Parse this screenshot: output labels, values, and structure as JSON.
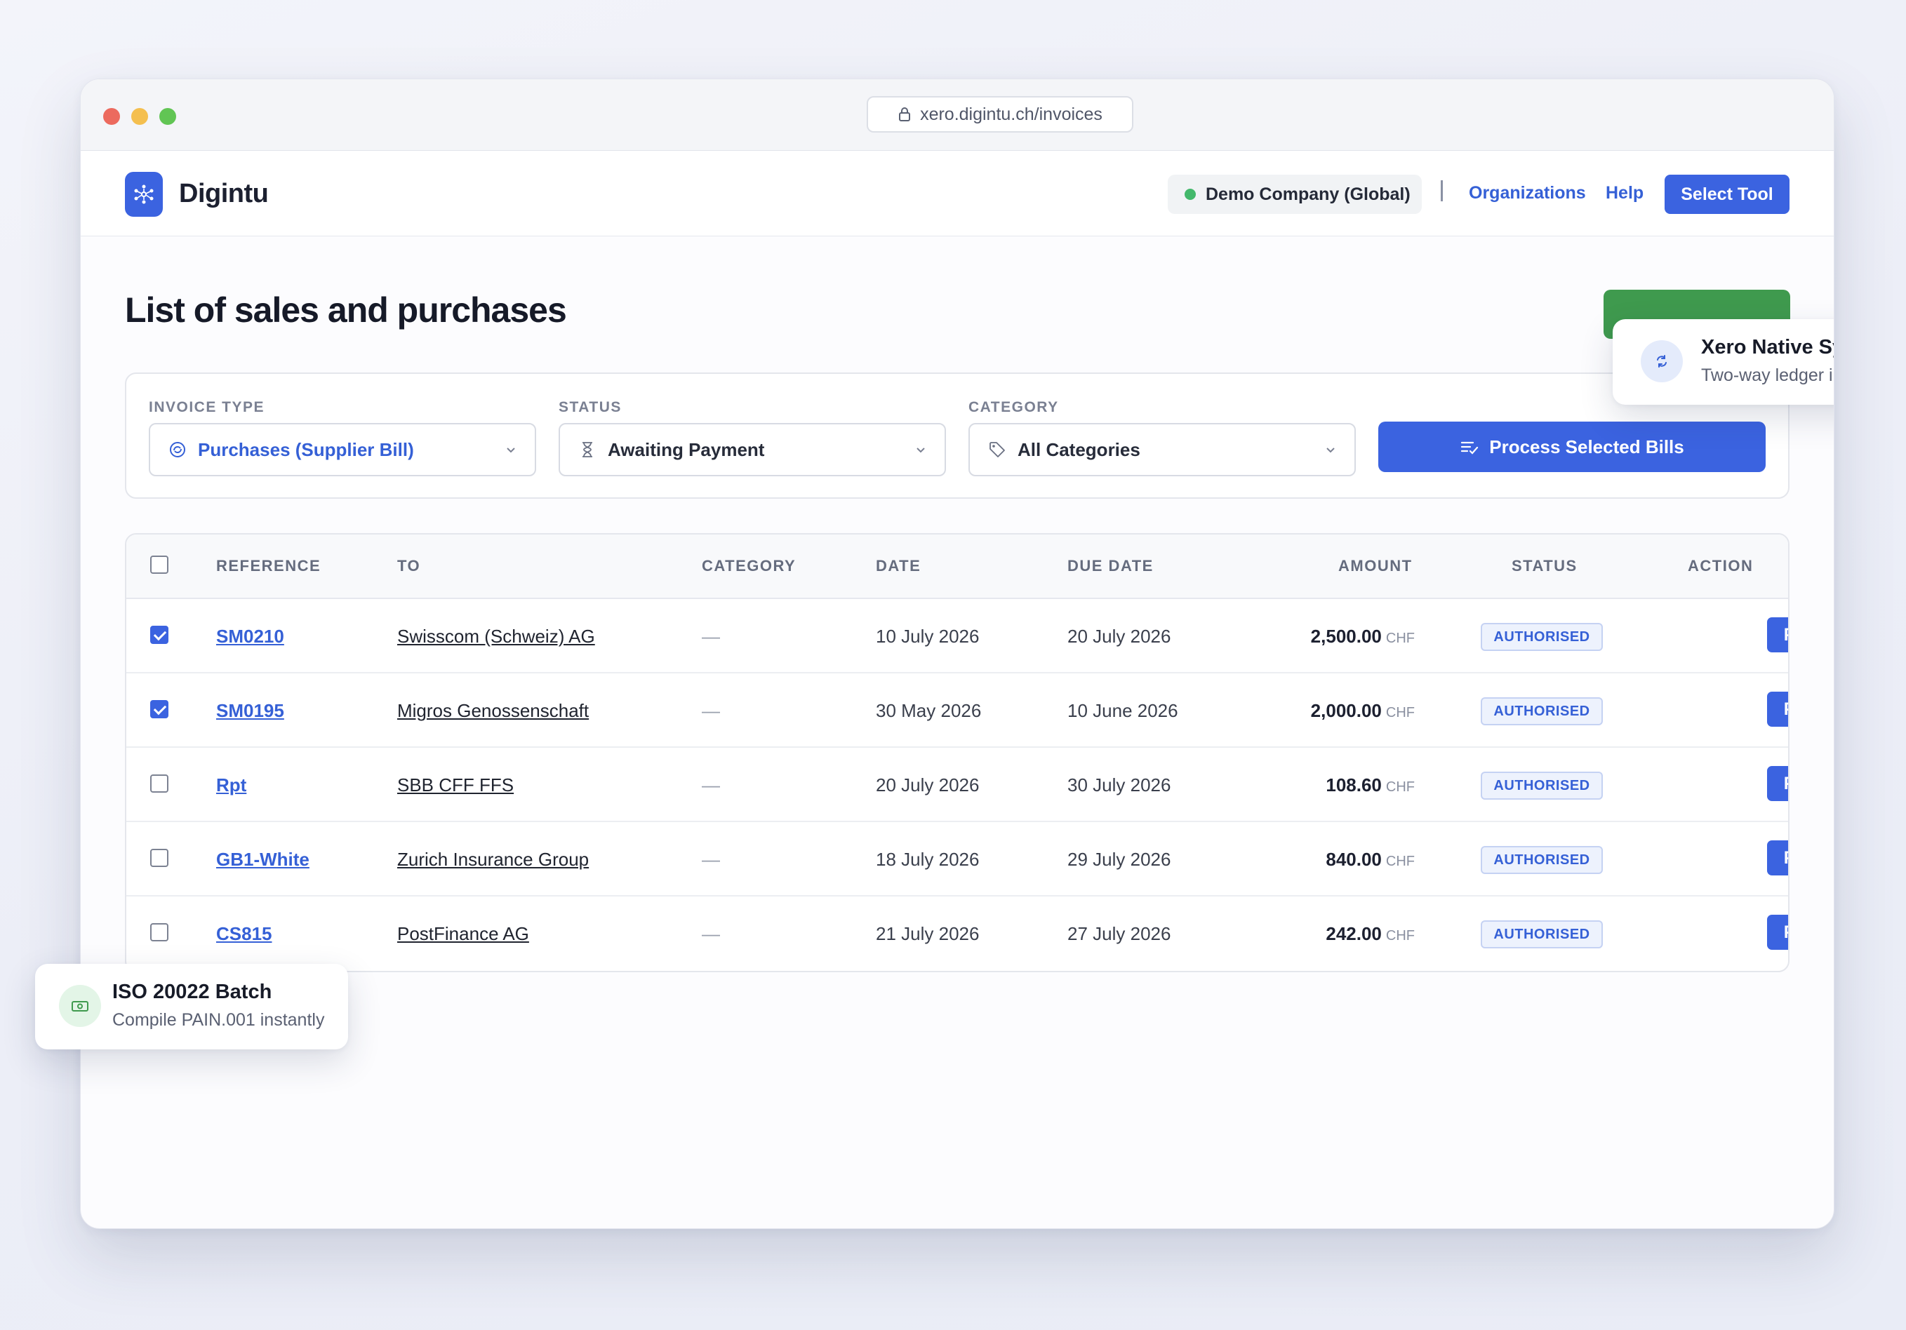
{
  "browser": {
    "url": "xero.digintu.ch/invoices"
  },
  "header": {
    "brand": "Digintu",
    "company": "Demo Company (Global)",
    "nav": {
      "organizations": "Organizations",
      "help": "Help",
      "select_tool": "Select Tool"
    }
  },
  "page": {
    "title": "List of sales and purchases"
  },
  "filters": {
    "invoice_type": {
      "label": "INVOICE TYPE",
      "value": "Purchases (Supplier Bill)"
    },
    "status": {
      "label": "STATUS",
      "value": "Awaiting Payment"
    },
    "category": {
      "label": "CATEGORY",
      "value": "All Categories"
    },
    "process_button": "Process Selected Bills"
  },
  "table": {
    "columns": {
      "reference": "REFERENCE",
      "to": "TO",
      "category": "CATEGORY",
      "date": "DATE",
      "due_date": "DUE DATE",
      "amount": "AMOUNT",
      "status": "STATUS",
      "action": "ACTION"
    },
    "rows": [
      {
        "checked": true,
        "reference": "SM0210",
        "to": "Swisscom (Schweiz) AG",
        "category": "—",
        "date": "10 July 2026",
        "due_date": "20 July 2026",
        "amount": "2,500.00",
        "currency": "CHF",
        "status": "AUTHORISED",
        "action": "Pay"
      },
      {
        "checked": true,
        "reference": "SM0195",
        "to": "Migros Genossenschaft",
        "category": "—",
        "date": "30 May 2026",
        "due_date": "10 June 2026",
        "amount": "2,000.00",
        "currency": "CHF",
        "status": "AUTHORISED",
        "action": "Pay"
      },
      {
        "checked": false,
        "reference": "Rpt",
        "to": "SBB CFF FFS",
        "category": "—",
        "date": "20 July 2026",
        "due_date": "30 July 2026",
        "amount": "108.60",
        "currency": "CHF",
        "status": "AUTHORISED",
        "action": "Pay"
      },
      {
        "checked": false,
        "reference": "GB1-White",
        "to": "Zurich Insurance Group",
        "category": "—",
        "date": "18 July 2026",
        "due_date": "29 July 2026",
        "amount": "840.00",
        "currency": "CHF",
        "status": "AUTHORISED",
        "action": "Pay"
      },
      {
        "checked": false,
        "reference": "CS815",
        "to": "PostFinance AG",
        "category": "—",
        "date": "21 July 2026",
        "due_date": "27 July 2026",
        "amount": "242.00",
        "currency": "CHF",
        "status": "AUTHORISED",
        "action": "Pay"
      }
    ]
  },
  "toasts": {
    "xero": {
      "title": "Xero Native Sync",
      "subtitle": "Two-way ledger integration",
      "icon": "sync-icon"
    },
    "iso": {
      "title": "ISO 20022 Batch",
      "subtitle": "Compile PAIN.001 instantly",
      "icon": "banknote-icon"
    }
  },
  "colors": {
    "accent": "#3b63e0",
    "success": "#3f9a4e",
    "status_badge": "#edf2fd"
  }
}
